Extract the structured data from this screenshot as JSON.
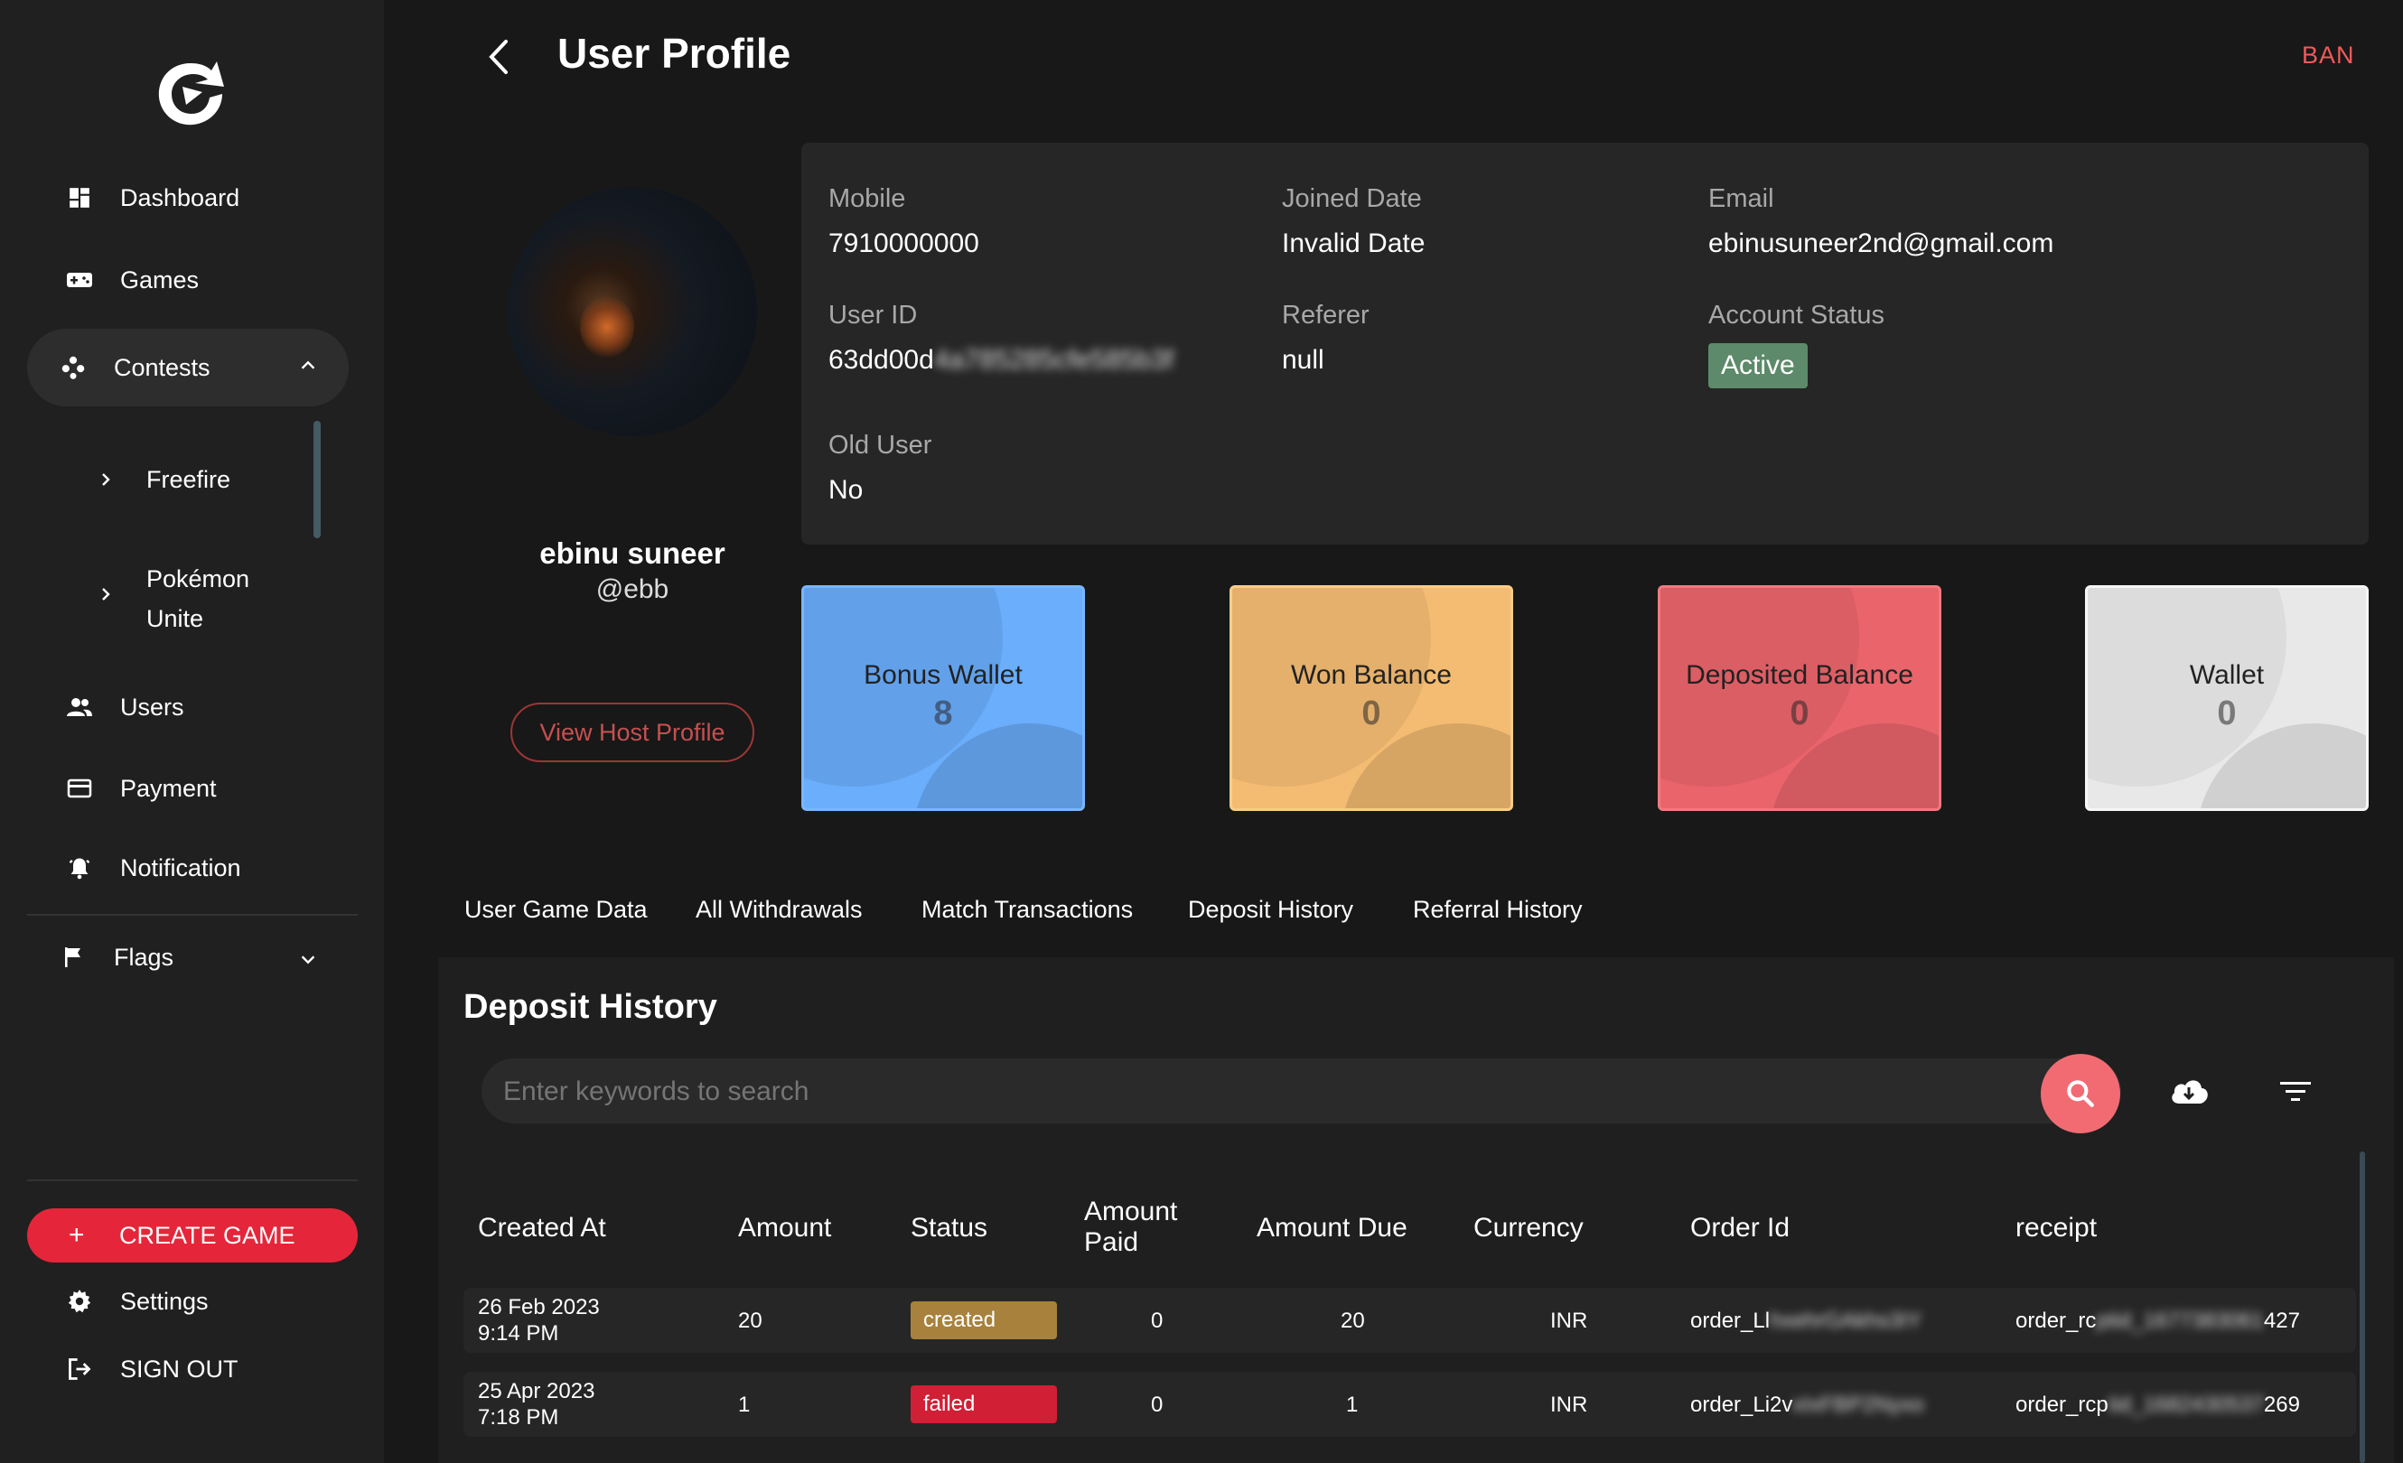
{
  "sidebar": {
    "items": [
      {
        "label": "Dashboard",
        "icon": "dashboard-icon"
      },
      {
        "label": "Games",
        "icon": "gamepad-icon"
      },
      {
        "label": "Contests",
        "icon": "contests-icon"
      },
      {
        "label": "Users",
        "icon": "users-icon"
      },
      {
        "label": "Payment",
        "icon": "card-icon"
      },
      {
        "label": "Notification",
        "icon": "bell-icon"
      },
      {
        "label": "Flags",
        "icon": "flag-icon"
      }
    ],
    "contest_sub": [
      "Freefire",
      "Pokémon Unite"
    ],
    "create_game": "CREATE GAME",
    "settings": "Settings",
    "sign_out": "SIGN OUT"
  },
  "header": {
    "title": "User Profile",
    "ban": "BAN"
  },
  "profile": {
    "name": "ebinu suneer",
    "handle": "@ebb",
    "view_host": "View Host Profile"
  },
  "info": {
    "mobile_label": "Mobile",
    "mobile": "7910000000",
    "joined_label": "Joined Date",
    "joined": "Invalid Date",
    "email_label": "Email",
    "email": "ebinusuneer2nd@gmail.com",
    "userid_label": "User ID",
    "userid_visible": "63dd00d",
    "userid_blurred": "4a785285cfe585b3f",
    "referer_label": "Referer",
    "referer": "null",
    "status_label": "Account Status",
    "status": "Active",
    "old_label": "Old User",
    "old": "No"
  },
  "cards": [
    {
      "title": "Bonus Wallet",
      "value": "8",
      "color": "#6aaefc"
    },
    {
      "title": "Won Balance",
      "value": "0",
      "color": "#f9c47a"
    },
    {
      "title": "Deposited Balance",
      "value": "0",
      "color": "#ec6a70"
    },
    {
      "title": "Wallet",
      "value": "0",
      "color": "#ececec"
    }
  ],
  "tabs": [
    "User Game Data",
    "All Withdrawals",
    "Match Transactions",
    "Deposit History",
    "Referral History"
  ],
  "deposit": {
    "title": "Deposit History",
    "search_placeholder": "Enter keywords to search",
    "columns": [
      "Created At",
      "Amount",
      "Status",
      "Amount Paid",
      "Amount Due",
      "Currency",
      "Order Id",
      "receipt"
    ],
    "rows": [
      {
        "date": "26 Feb 2023",
        "time": "9:14 PM",
        "amount": "20",
        "status": "created",
        "status_color": "#a8823c",
        "paid": "0",
        "due": "20",
        "currency": "INR",
        "order_vis": "order_Ll",
        "order_blur": "hxehrGAkhs3IY",
        "receipt_vis": "order_rc",
        "receipt_blur": "ptid_1677383061",
        "receipt_end": "427"
      },
      {
        "date": "25 Apr 2023",
        "time": "7:18 PM",
        "amount": "1",
        "status": "failed",
        "status_color": "#d11f35",
        "paid": "0",
        "due": "1",
        "currency": "INR",
        "order_vis": "order_Li2v",
        "order_blur": "xIxFBP2Nyxo",
        "receipt_vis": "order_rcp",
        "receipt_blur": "tid_1682430537",
        "receipt_end": "269"
      }
    ]
  }
}
